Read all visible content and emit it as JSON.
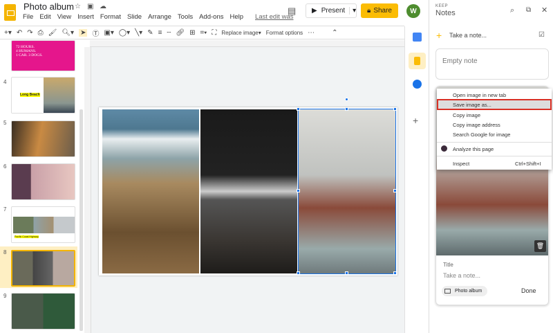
{
  "header": {
    "title": "Photo album",
    "menu": [
      "File",
      "Edit",
      "View",
      "Insert",
      "Format",
      "Slide",
      "Arrange",
      "Tools",
      "Add-ons",
      "Help"
    ],
    "last_edit": "Last edit was",
    "present": "Present",
    "share": "Share",
    "avatar": "W"
  },
  "toolbar": {
    "replace_image": "Replace image",
    "format_options": "Format options"
  },
  "slides": [
    {
      "num": "",
      "text": "72 HOURS.\n4 HUMANS.\n1 CAR. 3 DOGS."
    },
    {
      "num": "4",
      "text": "Long Beach"
    },
    {
      "num": "5",
      "text": ""
    },
    {
      "num": "6",
      "text": ""
    },
    {
      "num": "7",
      "text": "Pacific Coast Highway"
    },
    {
      "num": "8",
      "text": ""
    },
    {
      "num": "9",
      "text": ""
    }
  ],
  "keep": {
    "label": "KEEP",
    "title": "Notes",
    "take_note": "Take a note...",
    "empty_note": "Empty note",
    "note_title_placeholder": "Title",
    "note_body_placeholder": "Take a note...",
    "chip": "Photo album",
    "done": "Done"
  },
  "context_menu": {
    "items": [
      "Open image in new tab",
      "Save image as...",
      "Copy image",
      "Copy image address",
      "Search Google for image",
      "Analyze this page",
      "Inspect"
    ],
    "shortcut": "Ctrl+Shift+I",
    "highlight_color": "#d93025"
  }
}
